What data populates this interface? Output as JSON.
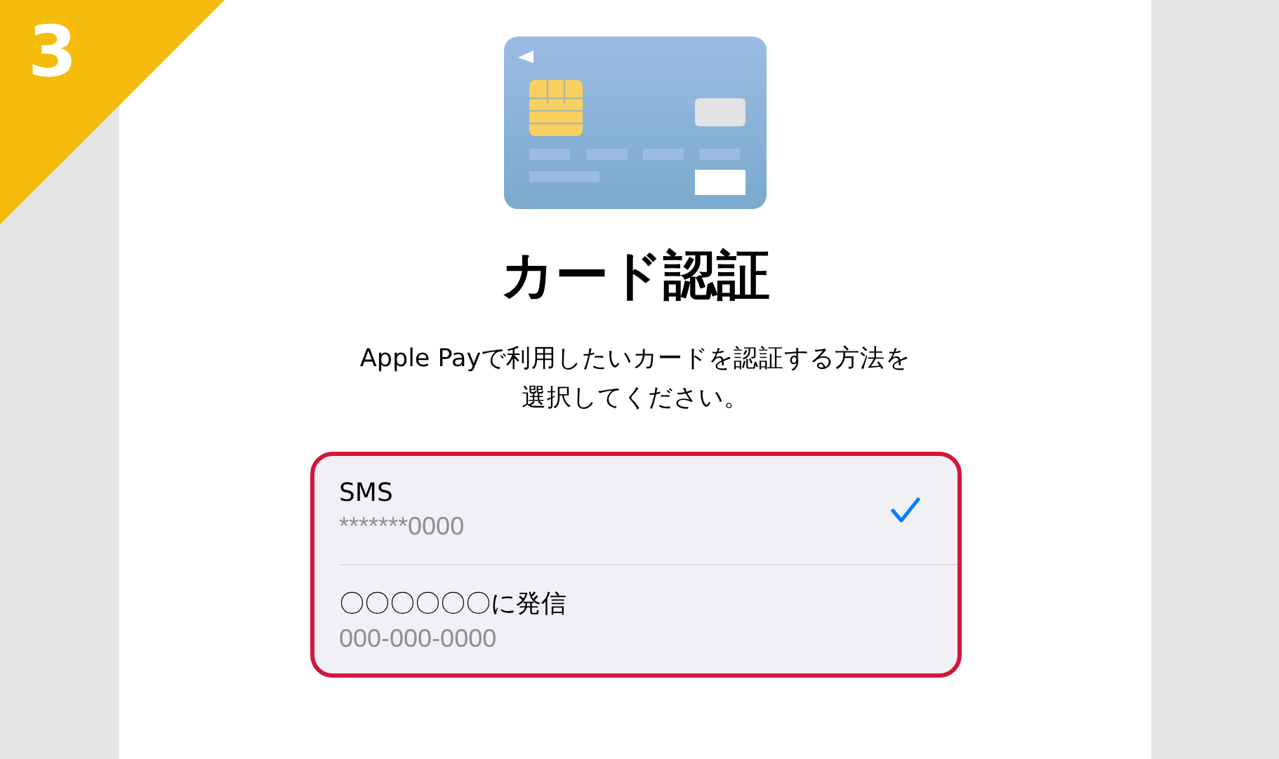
{
  "step_badge": "3",
  "title": "カード認証",
  "description": "Apple Payで利用したいカードを認証する方法を選択してください。",
  "methods": [
    {
      "label": "SMS",
      "detail": "*******0000",
      "selected": true
    },
    {
      "label": "〇〇〇〇〇〇に発信",
      "detail": "000-000-0000",
      "selected": false
    }
  ]
}
